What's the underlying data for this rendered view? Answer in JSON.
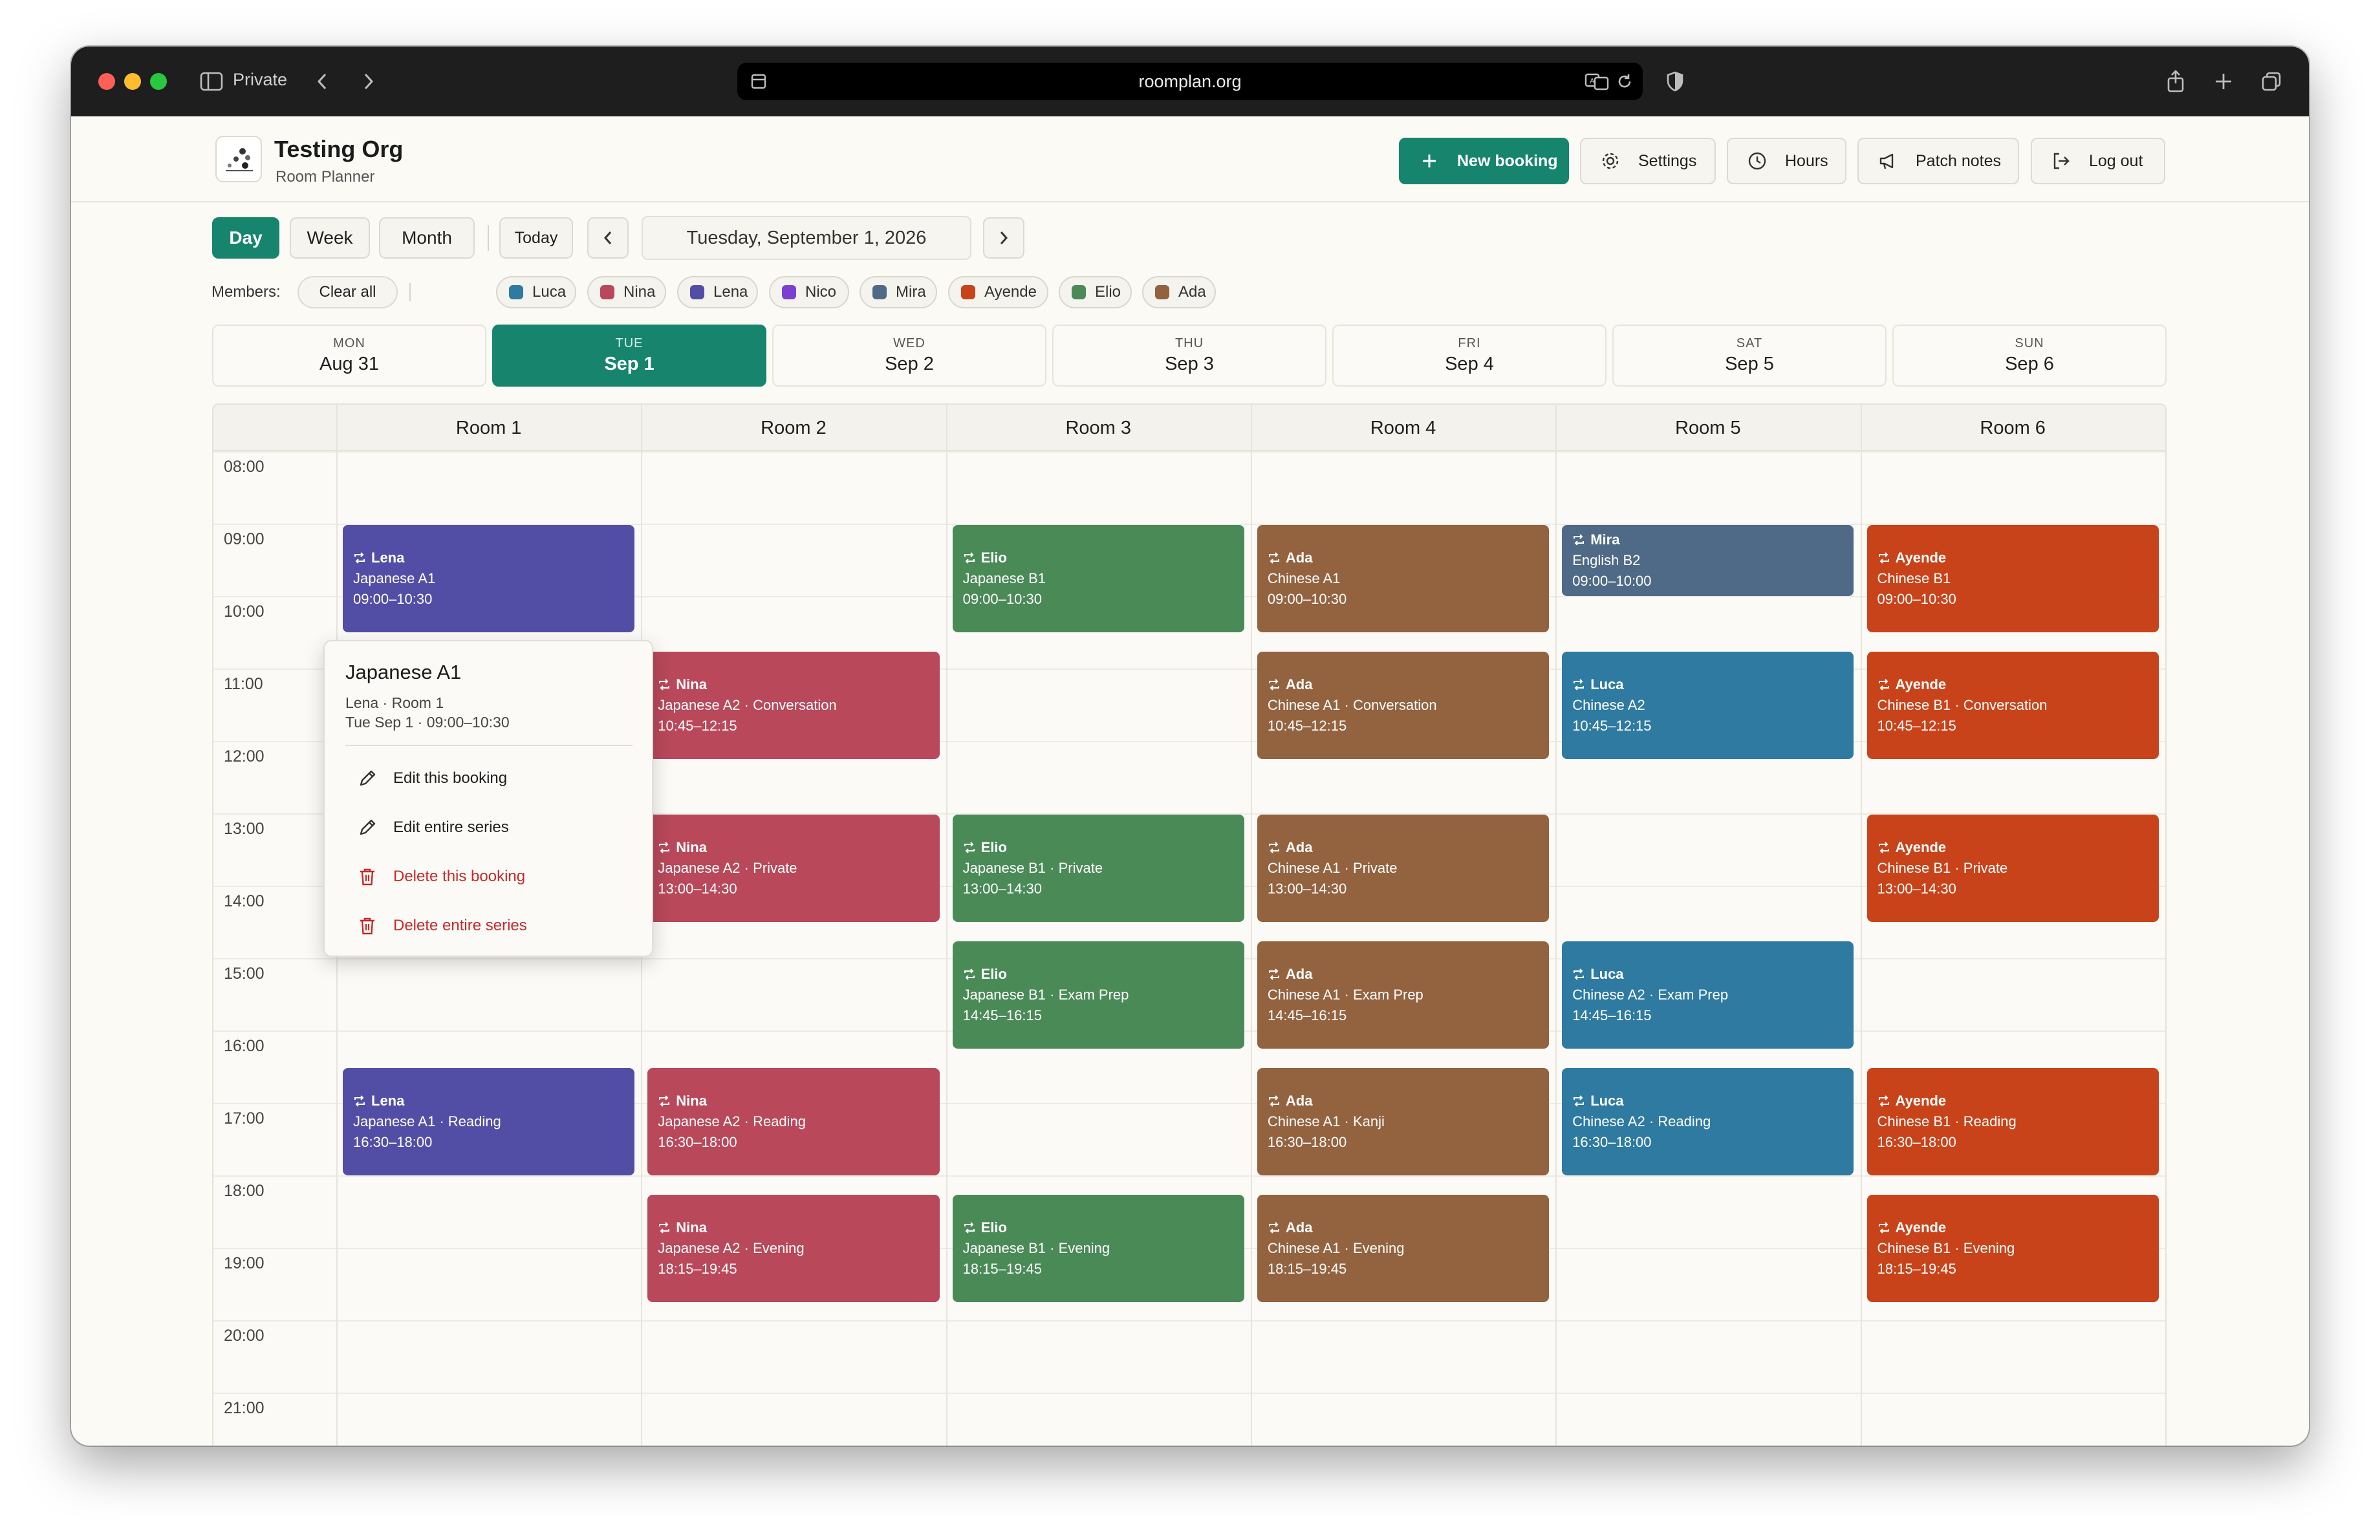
{
  "browser": {
    "private_label": "Private",
    "url": "roomplan.org"
  },
  "header": {
    "org_name": "Testing Org",
    "app_name": "Room Planner",
    "buttons": {
      "new_booking": "New booking",
      "settings": "Settings",
      "hours": "Hours",
      "patch_notes": "Patch notes",
      "log_out": "Log out"
    }
  },
  "toolbar": {
    "views": {
      "day": "Day",
      "week": "Week",
      "month": "Month"
    },
    "active_view": "Day",
    "today": "Today",
    "date": "Tuesday, September 1, 2026"
  },
  "members": {
    "label": "Members:",
    "clear_all": "Clear all",
    "chips": [
      {
        "name": "Luca",
        "color": "#2e7aa0"
      },
      {
        "name": "Nina",
        "color": "#b8485a"
      },
      {
        "name": "Lena",
        "color": "#534ea5"
      },
      {
        "name": "Nico",
        "color": "#7b3fd2"
      },
      {
        "name": "Mira",
        "color": "#4f6a86"
      },
      {
        "name": "Ayende",
        "color": "#c8431a"
      },
      {
        "name": "Elio",
        "color": "#4a8a57"
      },
      {
        "name": "Ada",
        "color": "#93623f"
      }
    ]
  },
  "days": [
    {
      "dow": "MON",
      "date": "Aug 31",
      "active": false
    },
    {
      "dow": "TUE",
      "date": "Sep 1",
      "active": true
    },
    {
      "dow": "WED",
      "date": "Sep 2",
      "active": false
    },
    {
      "dow": "THU",
      "date": "Sep 3",
      "active": false
    },
    {
      "dow": "FRI",
      "date": "Sep 4",
      "active": false
    },
    {
      "dow": "SAT",
      "date": "Sep 5",
      "active": false
    },
    {
      "dow": "SUN",
      "date": "Sep 6",
      "active": false
    }
  ],
  "rooms": [
    "Room 1",
    "Room 2",
    "Room 3",
    "Room 4",
    "Room 5",
    "Room 6"
  ],
  "hours": [
    "08:00",
    "09:00",
    "10:00",
    "11:00",
    "12:00",
    "13:00",
    "14:00",
    "15:00",
    "16:00",
    "17:00",
    "18:00",
    "19:00",
    "20:00",
    "21:00"
  ],
  "colors": {
    "accent": "#17846d",
    "Lena": "#534ea5",
    "Nina": "#b8485a",
    "Elio": "#4a8a57",
    "Ada": "#93623f",
    "Mira": "#4f6a86",
    "Luca": "#2e7aa0",
    "Ayende": "#c8431a",
    "danger": "#c42a2a"
  },
  "bookings": [
    {
      "room": 0,
      "member": "Lena",
      "title": "Japanese A1",
      "time": "09:00–10:30",
      "start": 9.0,
      "end": 10.5
    },
    {
      "room": 0,
      "member": "Lena",
      "title": "Japanese A1 · Reading",
      "time": "16:30–18:00",
      "start": 16.5,
      "end": 18.0
    },
    {
      "room": 1,
      "member": "Nina",
      "title": "Japanese A2 · Conversation",
      "time": "10:45–12:15",
      "start": 10.75,
      "end": 12.25
    },
    {
      "room": 1,
      "member": "Nina",
      "title": "Japanese A2 · Private",
      "time": "13:00–14:30",
      "start": 13.0,
      "end": 14.5
    },
    {
      "room": 1,
      "member": "Nina",
      "title": "Japanese A2 · Reading",
      "time": "16:30–18:00",
      "start": 16.5,
      "end": 18.0
    },
    {
      "room": 1,
      "member": "Nina",
      "title": "Japanese A2 · Evening",
      "time": "18:15–19:45",
      "start": 18.25,
      "end": 19.75
    },
    {
      "room": 2,
      "member": "Elio",
      "title": "Japanese B1",
      "time": "09:00–10:30",
      "start": 9.0,
      "end": 10.5
    },
    {
      "room": 2,
      "member": "Elio",
      "title": "Japanese B1 · Private",
      "time": "13:00–14:30",
      "start": 13.0,
      "end": 14.5
    },
    {
      "room": 2,
      "member": "Elio",
      "title": "Japanese B1 · Exam Prep",
      "time": "14:45–16:15",
      "start": 14.75,
      "end": 16.25
    },
    {
      "room": 2,
      "member": "Elio",
      "title": "Japanese B1 · Evening",
      "time": "18:15–19:45",
      "start": 18.25,
      "end": 19.75
    },
    {
      "room": 3,
      "member": "Ada",
      "title": "Chinese A1",
      "time": "09:00–10:30",
      "start": 9.0,
      "end": 10.5
    },
    {
      "room": 3,
      "member": "Ada",
      "title": "Chinese A1 · Conversation",
      "time": "10:45–12:15",
      "start": 10.75,
      "end": 12.25
    },
    {
      "room": 3,
      "member": "Ada",
      "title": "Chinese A1 · Private",
      "time": "13:00–14:30",
      "start": 13.0,
      "end": 14.5
    },
    {
      "room": 3,
      "member": "Ada",
      "title": "Chinese A1 · Exam Prep",
      "time": "14:45–16:15",
      "start": 14.75,
      "end": 16.25
    },
    {
      "room": 3,
      "member": "Ada",
      "title": "Chinese A1 · Kanji",
      "time": "16:30–18:00",
      "start": 16.5,
      "end": 18.0
    },
    {
      "room": 3,
      "member": "Ada",
      "title": "Chinese A1 · Evening",
      "time": "18:15–19:45",
      "start": 18.25,
      "end": 19.75
    },
    {
      "room": 4,
      "member": "Mira",
      "title": "English B2",
      "time": "09:00–10:00",
      "start": 9.0,
      "end": 10.0
    },
    {
      "room": 4,
      "member": "Luca",
      "title": "Chinese A2",
      "time": "10:45–12:15",
      "start": 10.75,
      "end": 12.25
    },
    {
      "room": 4,
      "member": "Luca",
      "title": "Chinese A2 · Exam Prep",
      "time": "14:45–16:15",
      "start": 14.75,
      "end": 16.25
    },
    {
      "room": 4,
      "member": "Luca",
      "title": "Chinese A2 · Reading",
      "time": "16:30–18:00",
      "start": 16.5,
      "end": 18.0
    },
    {
      "room": 5,
      "member": "Ayende",
      "title": "Chinese B1",
      "time": "09:00–10:30",
      "start": 9.0,
      "end": 10.5
    },
    {
      "room": 5,
      "member": "Ayende",
      "title": "Chinese B1 · Conversation",
      "time": "10:45–12:15",
      "start": 10.75,
      "end": 12.25
    },
    {
      "room": 5,
      "member": "Ayende",
      "title": "Chinese B1 · Private",
      "time": "13:00–14:30",
      "start": 13.0,
      "end": 14.5
    },
    {
      "room": 5,
      "member": "Ayende",
      "title": "Chinese B1 · Reading",
      "time": "16:30–18:00",
      "start": 16.5,
      "end": 18.0
    },
    {
      "room": 5,
      "member": "Ayende",
      "title": "Chinese B1 · Evening",
      "time": "18:15–19:45",
      "start": 18.25,
      "end": 19.75
    }
  ],
  "popover": {
    "title": "Japanese A1",
    "subtitle": "Lena · Room 1",
    "detail": "Tue Sep 1 · 09:00–10:30",
    "actions": {
      "edit_booking": "Edit this booking",
      "edit_series": "Edit entire series",
      "delete_booking": "Delete this booking",
      "delete_series": "Delete entire series"
    }
  }
}
